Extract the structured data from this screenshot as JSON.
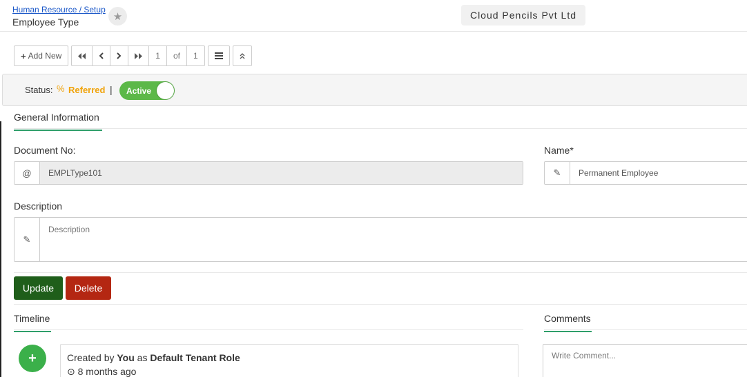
{
  "header": {
    "breadcrumb": "Human Resource / Setup",
    "title": "Employee Type",
    "company": "Cloud Pencils Pvt Ltd"
  },
  "toolbar": {
    "add_new_label": "Add New",
    "current_page": "1",
    "of_label": "of",
    "total_pages": "1"
  },
  "status": {
    "label": "Status:",
    "value": "Referred",
    "separator": "|",
    "toggle_label": "Active",
    "toggle_on": true,
    "colors": {
      "referred": "#f0a30a",
      "active": "#5cb848"
    }
  },
  "general": {
    "section_title": "General Information",
    "document_no_label": "Document No:",
    "document_no_value": "EMPLType101",
    "document_no_icon": "at-icon",
    "name_label": "Name*",
    "name_value": "Permanent Employee",
    "description_label": "Description",
    "description_placeholder": "Description"
  },
  "actions": {
    "update_label": "Update",
    "delete_label": "Delete",
    "colors": {
      "update": "#1f5e1a",
      "delete": "#b42712"
    }
  },
  "timeline": {
    "section_title": "Timeline",
    "entries": [
      {
        "prefix": "Created by",
        "actor": "You",
        "middle": "as",
        "role": "Default Tenant Role",
        "time": "8 months ago"
      }
    ]
  },
  "comments": {
    "section_title": "Comments",
    "placeholder": "Write Comment..."
  }
}
